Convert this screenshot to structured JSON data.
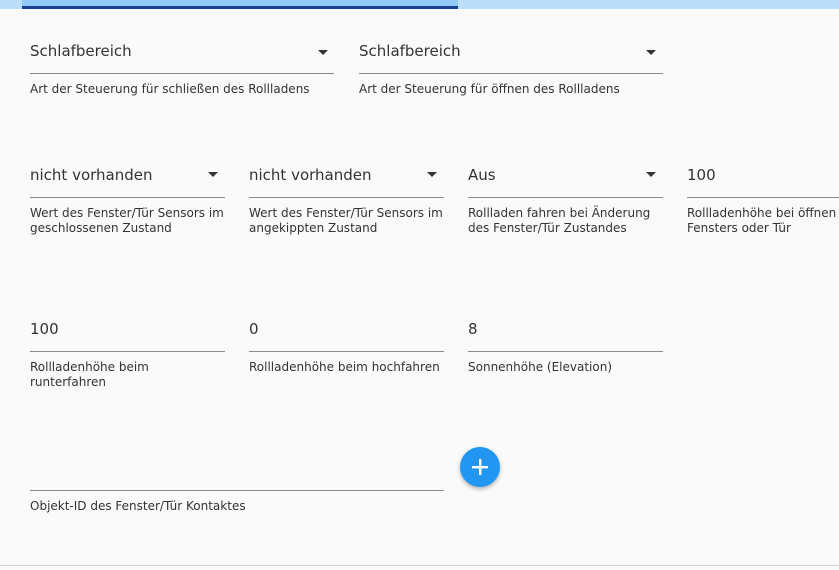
{
  "fields": {
    "close_control": {
      "value": "Schlafbereich",
      "helper": "Art der Steuerung für schließen des Rollladens"
    },
    "open_control": {
      "value": "Schlafbereich",
      "helper": "Art der Steuerung für öffnen des Rollladens"
    },
    "sensor_closed": {
      "value": "nicht vorhanden",
      "helper": "Wert des Fenster/Tür Sensors im geschlossenen Zustand"
    },
    "sensor_tilted": {
      "value": "nicht vorhanden",
      "helper": "Wert des Fenster/Tür Sensors im angekippten Zustand"
    },
    "drive_on_change": {
      "value": "Aus",
      "helper": "Rollladen fahren bei Änderung des Fenster/Tür Zustandes"
    },
    "height_open": {
      "value": "100",
      "helper": "Rollladenhöhe bei öffnen des Fensters oder Tür"
    },
    "height_down": {
      "value": "100",
      "helper": "Rollladenhöhe beim runterfahren"
    },
    "height_up": {
      "value": "0",
      "helper": "Rollladenhöhe beim hochfahren"
    },
    "elevation": {
      "value": "8",
      "helper": "Sonnenhöhe (Elevation)"
    },
    "contact_id": {
      "value": "",
      "helper": "Objekt-ID des Fenster/Tür Kontaktes"
    }
  },
  "add_button": {
    "icon": "plus-icon"
  },
  "colors": {
    "accent": "#2196f3",
    "tab_active": "#1a3d8f",
    "tab_bg": "#bbdefb"
  }
}
